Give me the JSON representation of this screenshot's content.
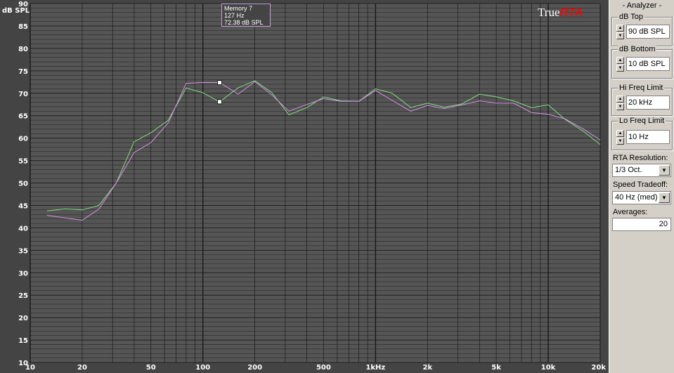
{
  "plot": {
    "y_unit_label": "dB SPL",
    "y_ticks": [
      "90",
      "85",
      "80",
      "75",
      "70",
      "65",
      "60",
      "55",
      "50",
      "45",
      "40",
      "35",
      "30",
      "25",
      "20",
      "15",
      "10"
    ],
    "x_ticks": [
      {
        "label": "10",
        "f": 10
      },
      {
        "label": "20",
        "f": 20
      },
      {
        "label": "50",
        "f": 50
      },
      {
        "label": "100",
        "f": 100
      },
      {
        "label": "200",
        "f": 200
      },
      {
        "label": "500",
        "f": 500
      },
      {
        "label": "1kHz",
        "f": 1000
      },
      {
        "label": "2k",
        "f": 2000
      },
      {
        "label": "5k",
        "f": 5000
      },
      {
        "label": "10k",
        "f": 10000
      },
      {
        "label": "20k",
        "f": 20000
      }
    ],
    "memory_tooltip": {
      "line1": "Memory 7",
      "line2": "127 Hz",
      "line3": "72.38 dB SPL"
    },
    "logo": {
      "true": "True",
      "rta": "RTA"
    },
    "colors": {
      "background": "#444444",
      "grid": "#000000",
      "green_trace": "#80e080",
      "purple_trace": "#d890e8"
    }
  },
  "chart_data": {
    "type": "line",
    "x_scale": "log",
    "xlim": [
      10,
      20000
    ],
    "ylim": [
      10,
      90
    ],
    "ylabel": "dB SPL",
    "series": [
      {
        "color": "#80e080",
        "x": [
          12.5,
          16,
          20,
          25,
          31.5,
          40,
          50,
          63,
          80,
          100,
          125,
          160,
          200,
          250,
          315,
          400,
          500,
          630,
          800,
          1000,
          1250,
          1600,
          2000,
          2500,
          3150,
          4000,
          5000,
          6300,
          8000,
          10000,
          12500,
          16000,
          20000
        ],
        "y": [
          43.8,
          44.2,
          44,
          45,
          50,
          59.2,
          61.2,
          64,
          71.2,
          70.1,
          68.1,
          71.2,
          72.8,
          70.2,
          65.2,
          66.8,
          69.2,
          68.3,
          68.2,
          71,
          70,
          66.8,
          67.8,
          66.9,
          67.6,
          69.8,
          69.2,
          68.3,
          66.8,
          67.4,
          64.2,
          61.5,
          58.6
        ]
      },
      {
        "color": "#d890e8",
        "x": [
          12.5,
          16,
          20,
          25,
          31.5,
          40,
          50,
          63,
          80,
          100,
          125,
          160,
          200,
          250,
          315,
          400,
          500,
          630,
          800,
          1000,
          1250,
          1600,
          2000,
          2500,
          3150,
          4000,
          5000,
          6300,
          8000,
          10000,
          12500,
          16000,
          20000
        ],
        "y": [
          42.8,
          42.2,
          41.7,
          44.2,
          50,
          56.8,
          59,
          63.4,
          72.2,
          72.4,
          72.38,
          69.8,
          72.6,
          69.7,
          66,
          67.5,
          68.8,
          68.2,
          68.2,
          70.6,
          68.4,
          66,
          67.3,
          66.6,
          67.4,
          68.3,
          67.8,
          67.8,
          65.7,
          65.3,
          64.3,
          62,
          59.6
        ]
      }
    ]
  },
  "panel": {
    "title": "- Analyzer -",
    "db_top": {
      "label": "dB Top",
      "value": "90 dB SPL"
    },
    "db_bottom": {
      "label": "dB Bottom",
      "value": "10 dB SPL"
    },
    "hi_freq": {
      "label": "Hi Freq Limit",
      "value": "20 kHz"
    },
    "lo_freq": {
      "label": "Lo Freq Limit",
      "value": "10 Hz"
    },
    "rta_resolution": {
      "label": "RTA Resolution:",
      "value": "1/3 Oct."
    },
    "speed_tradeoff": {
      "label": "Speed Tradeoff:",
      "value": "40 Hz (med)"
    },
    "averages": {
      "label": "Averages:",
      "value": "20"
    }
  }
}
